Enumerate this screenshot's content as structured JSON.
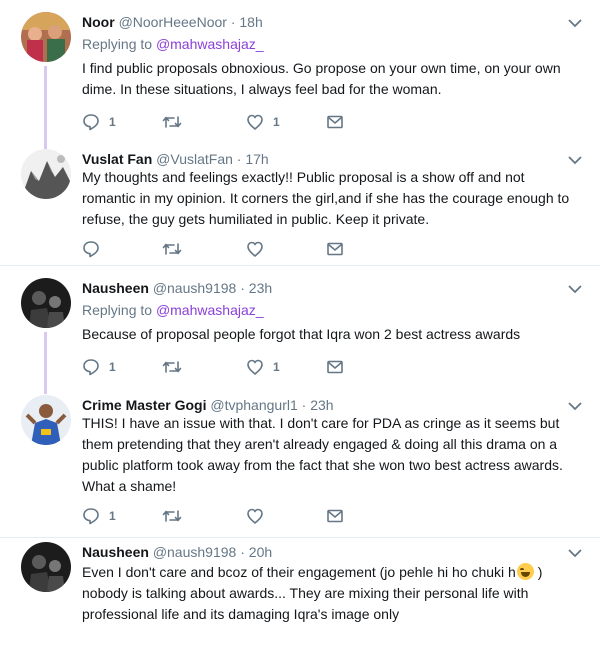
{
  "tweets": [
    {
      "name": "Noor",
      "handle": "@NoorHeeeNoor",
      "time": "18h",
      "replying_prefix": "Replying to ",
      "replying_to": "@mahwashajaz_",
      "text": "I find public proposals obnoxious. Go propose on your own time, on your own dime. In these situations, I always feel bad for the woman.",
      "reply_count": "1",
      "retweet_count": "",
      "like_count": "1"
    },
    {
      "name": "Vuslat Fan",
      "handle": "@VuslatFan",
      "time": "17h",
      "text": "My thoughts and feelings exactly!! Public proposal is a show off and not romantic in my opinion. It corners the girl,and if she has the courage enough to refuse, the guy gets humiliated in public. Keep it private.",
      "reply_count": "",
      "retweet_count": "",
      "like_count": ""
    },
    {
      "name": "Nausheen",
      "handle": "@naush9198",
      "time": "23h",
      "replying_prefix": "Replying to ",
      "replying_to": "@mahwashajaz_",
      "text": "Because of proposal people forgot that Iqra won 2 best actress awards",
      "reply_count": "1",
      "retweet_count": "",
      "like_count": "1"
    },
    {
      "name": "Crime Master Gogi",
      "handle": "@tvphangurl1",
      "time": "23h",
      "text": "THIS! I have an issue with that. I don't care for PDA as cringe as it seems but them pretending that they aren't already engaged & doing all this drama on a public platform took away from the fact that she won two best actress awards. What a shame!",
      "reply_count": "1",
      "retweet_count": "",
      "like_count": ""
    },
    {
      "name": "Nausheen",
      "handle": "@naush9198",
      "time": "20h",
      "text_a": "Even I don't care and bcoz of their engagement (jo pehle hi ho chuki h",
      "text_b": " ) nobody is talking about awards... They are mixing  their personal life with professional life and its damaging Iqra's image only"
    }
  ],
  "dot": "·",
  "colors": {
    "accent": "#8b3fd9",
    "thread_line": "#d8c8f2",
    "muted": "#657786",
    "divider": "#e6ecf0"
  }
}
